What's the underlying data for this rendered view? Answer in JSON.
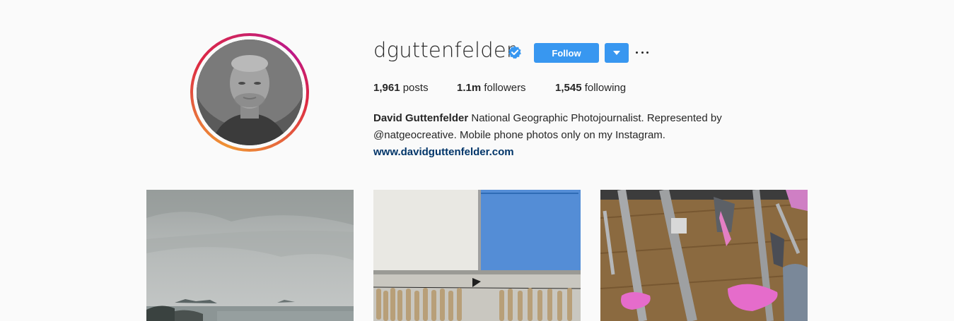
{
  "profile": {
    "username": "dguttenfelder",
    "verified": true,
    "follow_label": "Follow",
    "stats": {
      "posts_count": "1,961",
      "posts_label": "posts",
      "followers_count": "1.1m",
      "followers_label": "followers",
      "following_count": "1,545",
      "following_label": "following"
    },
    "bio": {
      "full_name": "David Guttenfelder",
      "text_line1": "National Geographic Photojournalist. Represented by",
      "text_line2": "@natgeocreative. Mobile phone photos only on my Instagram.",
      "website": "www.davidguttenfelder.com"
    }
  },
  "colors": {
    "accent": "#3897f0",
    "link": "#003569",
    "text": "#262626",
    "background": "#fafafa"
  },
  "icons": {
    "verified": "verified-badge-icon",
    "dropdown": "caret-down-icon",
    "more": "ellipsis-icon"
  }
}
